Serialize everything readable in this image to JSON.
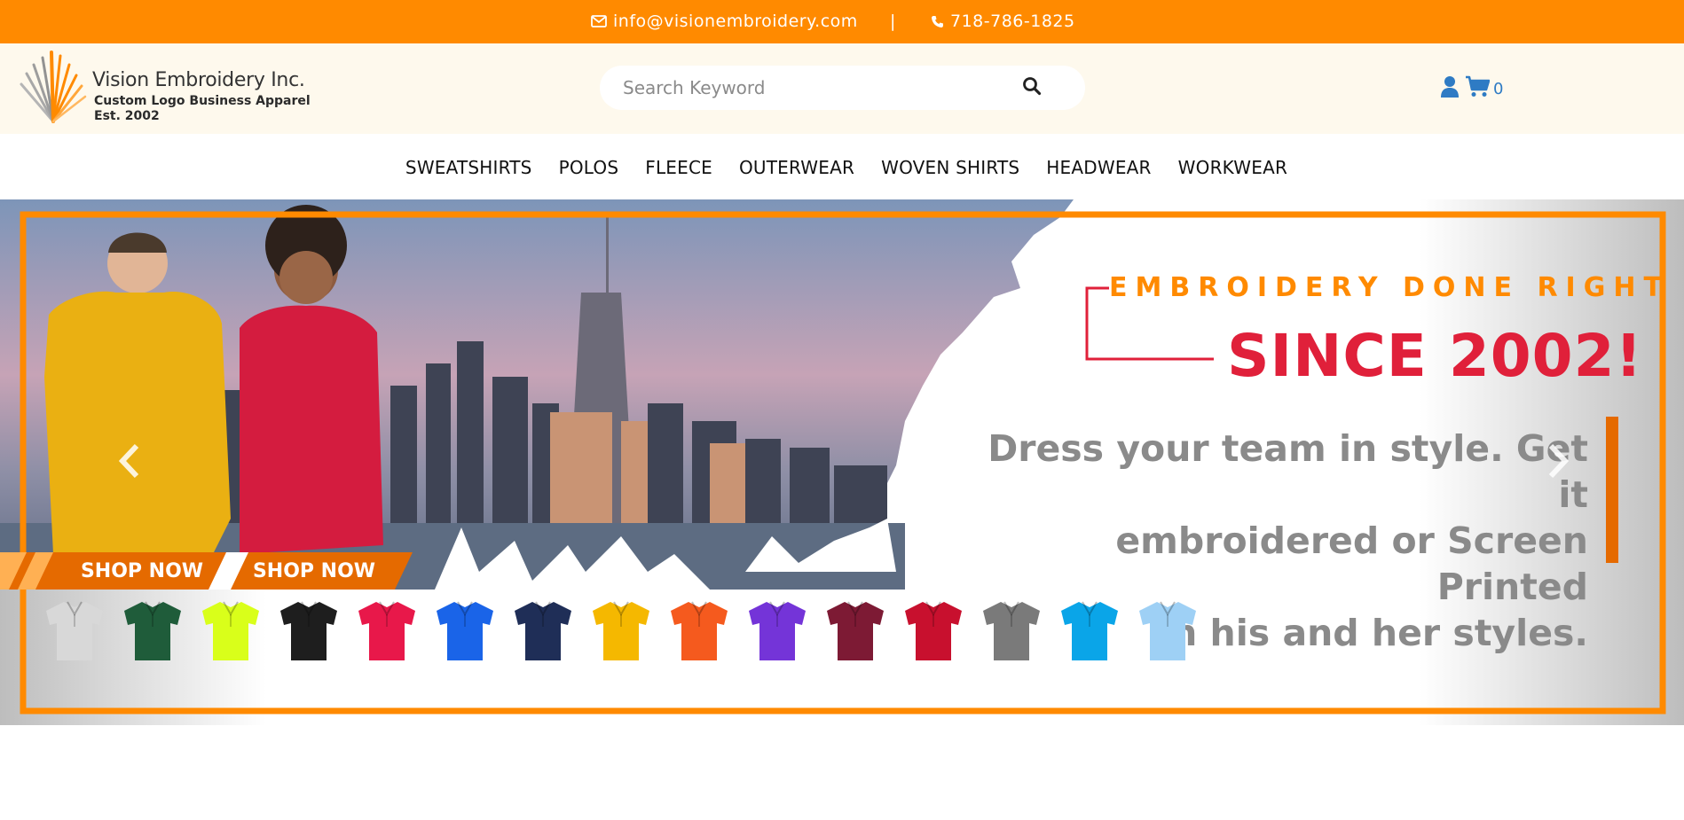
{
  "topbar": {
    "email": "info@visionembroidery.com",
    "separator": "|",
    "phone": "718-786-1825",
    "bg_color": "#ff8a00"
  },
  "header": {
    "logo": {
      "brand": "Vision Embroidery Inc.",
      "tagline": "Custom Logo Business Apparel",
      "est": "Est. 2002"
    },
    "search": {
      "placeholder": "Search Keyword",
      "icon": "search-icon"
    },
    "user_icon": "user-icon",
    "cart_icon": "cart-icon",
    "cart_count": "0",
    "bg_color": "#fef9ed"
  },
  "nav": {
    "items": [
      "SWEATSHIRTS",
      "POLOS",
      "FLEECE",
      "OUTERWEAR",
      "WOVEN SHIRTS",
      "HEADWEAR",
      "WORKWEAR"
    ]
  },
  "banner": {
    "headline1": "EMBROIDERY DONE RIGHT",
    "headline2": "SINCE 2002!",
    "tagline_lines": [
      "Dress your team in style. Get it",
      "embroidered or Screen Printed",
      "in his and her styles."
    ],
    "shop_buttons": [
      "SHOP NOW",
      "SHOP NOW"
    ],
    "prev_icon": "chevron-left-icon",
    "next_icon": "chevron-right-icon",
    "swatch_colors": [
      "#d8d8d8",
      "#1f5c3a",
      "#d9ff1a",
      "#1e1e1e",
      "#e8184a",
      "#1a64e8",
      "#1f2e57",
      "#f5b800",
      "#f55a1e",
      "#7434d8",
      "#7d1a34",
      "#c8102e",
      "#7a7a7a",
      "#0aa5e8",
      "#9ed0f5"
    ],
    "accent_orange": "#ff8a00",
    "accent_red": "#e0203a"
  }
}
